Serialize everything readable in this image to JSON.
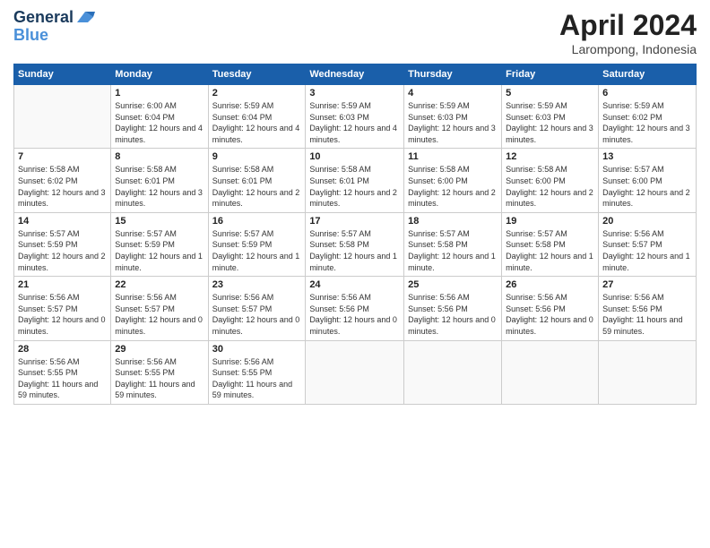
{
  "header": {
    "logo_line1": "General",
    "logo_line2": "Blue",
    "month_title": "April 2024",
    "location": "Larompong, Indonesia"
  },
  "days_of_week": [
    "Sunday",
    "Monday",
    "Tuesday",
    "Wednesday",
    "Thursday",
    "Friday",
    "Saturday"
  ],
  "weeks": [
    [
      {
        "day": "",
        "sunrise": "",
        "sunset": "",
        "daylight": ""
      },
      {
        "day": "1",
        "sunrise": "Sunrise: 6:00 AM",
        "sunset": "Sunset: 6:04 PM",
        "daylight": "Daylight: 12 hours and 4 minutes."
      },
      {
        "day": "2",
        "sunrise": "Sunrise: 5:59 AM",
        "sunset": "Sunset: 6:04 PM",
        "daylight": "Daylight: 12 hours and 4 minutes."
      },
      {
        "day": "3",
        "sunrise": "Sunrise: 5:59 AM",
        "sunset": "Sunset: 6:03 PM",
        "daylight": "Daylight: 12 hours and 4 minutes."
      },
      {
        "day": "4",
        "sunrise": "Sunrise: 5:59 AM",
        "sunset": "Sunset: 6:03 PM",
        "daylight": "Daylight: 12 hours and 3 minutes."
      },
      {
        "day": "5",
        "sunrise": "Sunrise: 5:59 AM",
        "sunset": "Sunset: 6:03 PM",
        "daylight": "Daylight: 12 hours and 3 minutes."
      },
      {
        "day": "6",
        "sunrise": "Sunrise: 5:59 AM",
        "sunset": "Sunset: 6:02 PM",
        "daylight": "Daylight: 12 hours and 3 minutes."
      }
    ],
    [
      {
        "day": "7",
        "sunrise": "Sunrise: 5:58 AM",
        "sunset": "Sunset: 6:02 PM",
        "daylight": "Daylight: 12 hours and 3 minutes."
      },
      {
        "day": "8",
        "sunrise": "Sunrise: 5:58 AM",
        "sunset": "Sunset: 6:01 PM",
        "daylight": "Daylight: 12 hours and 3 minutes."
      },
      {
        "day": "9",
        "sunrise": "Sunrise: 5:58 AM",
        "sunset": "Sunset: 6:01 PM",
        "daylight": "Daylight: 12 hours and 2 minutes."
      },
      {
        "day": "10",
        "sunrise": "Sunrise: 5:58 AM",
        "sunset": "Sunset: 6:01 PM",
        "daylight": "Daylight: 12 hours and 2 minutes."
      },
      {
        "day": "11",
        "sunrise": "Sunrise: 5:58 AM",
        "sunset": "Sunset: 6:00 PM",
        "daylight": "Daylight: 12 hours and 2 minutes."
      },
      {
        "day": "12",
        "sunrise": "Sunrise: 5:58 AM",
        "sunset": "Sunset: 6:00 PM",
        "daylight": "Daylight: 12 hours and 2 minutes."
      },
      {
        "day": "13",
        "sunrise": "Sunrise: 5:57 AM",
        "sunset": "Sunset: 6:00 PM",
        "daylight": "Daylight: 12 hours and 2 minutes."
      }
    ],
    [
      {
        "day": "14",
        "sunrise": "Sunrise: 5:57 AM",
        "sunset": "Sunset: 5:59 PM",
        "daylight": "Daylight: 12 hours and 2 minutes."
      },
      {
        "day": "15",
        "sunrise": "Sunrise: 5:57 AM",
        "sunset": "Sunset: 5:59 PM",
        "daylight": "Daylight: 12 hours and 1 minute."
      },
      {
        "day": "16",
        "sunrise": "Sunrise: 5:57 AM",
        "sunset": "Sunset: 5:59 PM",
        "daylight": "Daylight: 12 hours and 1 minute."
      },
      {
        "day": "17",
        "sunrise": "Sunrise: 5:57 AM",
        "sunset": "Sunset: 5:58 PM",
        "daylight": "Daylight: 12 hours and 1 minute."
      },
      {
        "day": "18",
        "sunrise": "Sunrise: 5:57 AM",
        "sunset": "Sunset: 5:58 PM",
        "daylight": "Daylight: 12 hours and 1 minute."
      },
      {
        "day": "19",
        "sunrise": "Sunrise: 5:57 AM",
        "sunset": "Sunset: 5:58 PM",
        "daylight": "Daylight: 12 hours and 1 minute."
      },
      {
        "day": "20",
        "sunrise": "Sunrise: 5:56 AM",
        "sunset": "Sunset: 5:57 PM",
        "daylight": "Daylight: 12 hours and 1 minute."
      }
    ],
    [
      {
        "day": "21",
        "sunrise": "Sunrise: 5:56 AM",
        "sunset": "Sunset: 5:57 PM",
        "daylight": "Daylight: 12 hours and 0 minutes."
      },
      {
        "day": "22",
        "sunrise": "Sunrise: 5:56 AM",
        "sunset": "Sunset: 5:57 PM",
        "daylight": "Daylight: 12 hours and 0 minutes."
      },
      {
        "day": "23",
        "sunrise": "Sunrise: 5:56 AM",
        "sunset": "Sunset: 5:57 PM",
        "daylight": "Daylight: 12 hours and 0 minutes."
      },
      {
        "day": "24",
        "sunrise": "Sunrise: 5:56 AM",
        "sunset": "Sunset: 5:56 PM",
        "daylight": "Daylight: 12 hours and 0 minutes."
      },
      {
        "day": "25",
        "sunrise": "Sunrise: 5:56 AM",
        "sunset": "Sunset: 5:56 PM",
        "daylight": "Daylight: 12 hours and 0 minutes."
      },
      {
        "day": "26",
        "sunrise": "Sunrise: 5:56 AM",
        "sunset": "Sunset: 5:56 PM",
        "daylight": "Daylight: 12 hours and 0 minutes."
      },
      {
        "day": "27",
        "sunrise": "Sunrise: 5:56 AM",
        "sunset": "Sunset: 5:56 PM",
        "daylight": "Daylight: 11 hours and 59 minutes."
      }
    ],
    [
      {
        "day": "28",
        "sunrise": "Sunrise: 5:56 AM",
        "sunset": "Sunset: 5:55 PM",
        "daylight": "Daylight: 11 hours and 59 minutes."
      },
      {
        "day": "29",
        "sunrise": "Sunrise: 5:56 AM",
        "sunset": "Sunset: 5:55 PM",
        "daylight": "Daylight: 11 hours and 59 minutes."
      },
      {
        "day": "30",
        "sunrise": "Sunrise: 5:56 AM",
        "sunset": "Sunset: 5:55 PM",
        "daylight": "Daylight: 11 hours and 59 minutes."
      },
      {
        "day": "",
        "sunrise": "",
        "sunset": "",
        "daylight": ""
      },
      {
        "day": "",
        "sunrise": "",
        "sunset": "",
        "daylight": ""
      },
      {
        "day": "",
        "sunrise": "",
        "sunset": "",
        "daylight": ""
      },
      {
        "day": "",
        "sunrise": "",
        "sunset": "",
        "daylight": ""
      }
    ]
  ]
}
